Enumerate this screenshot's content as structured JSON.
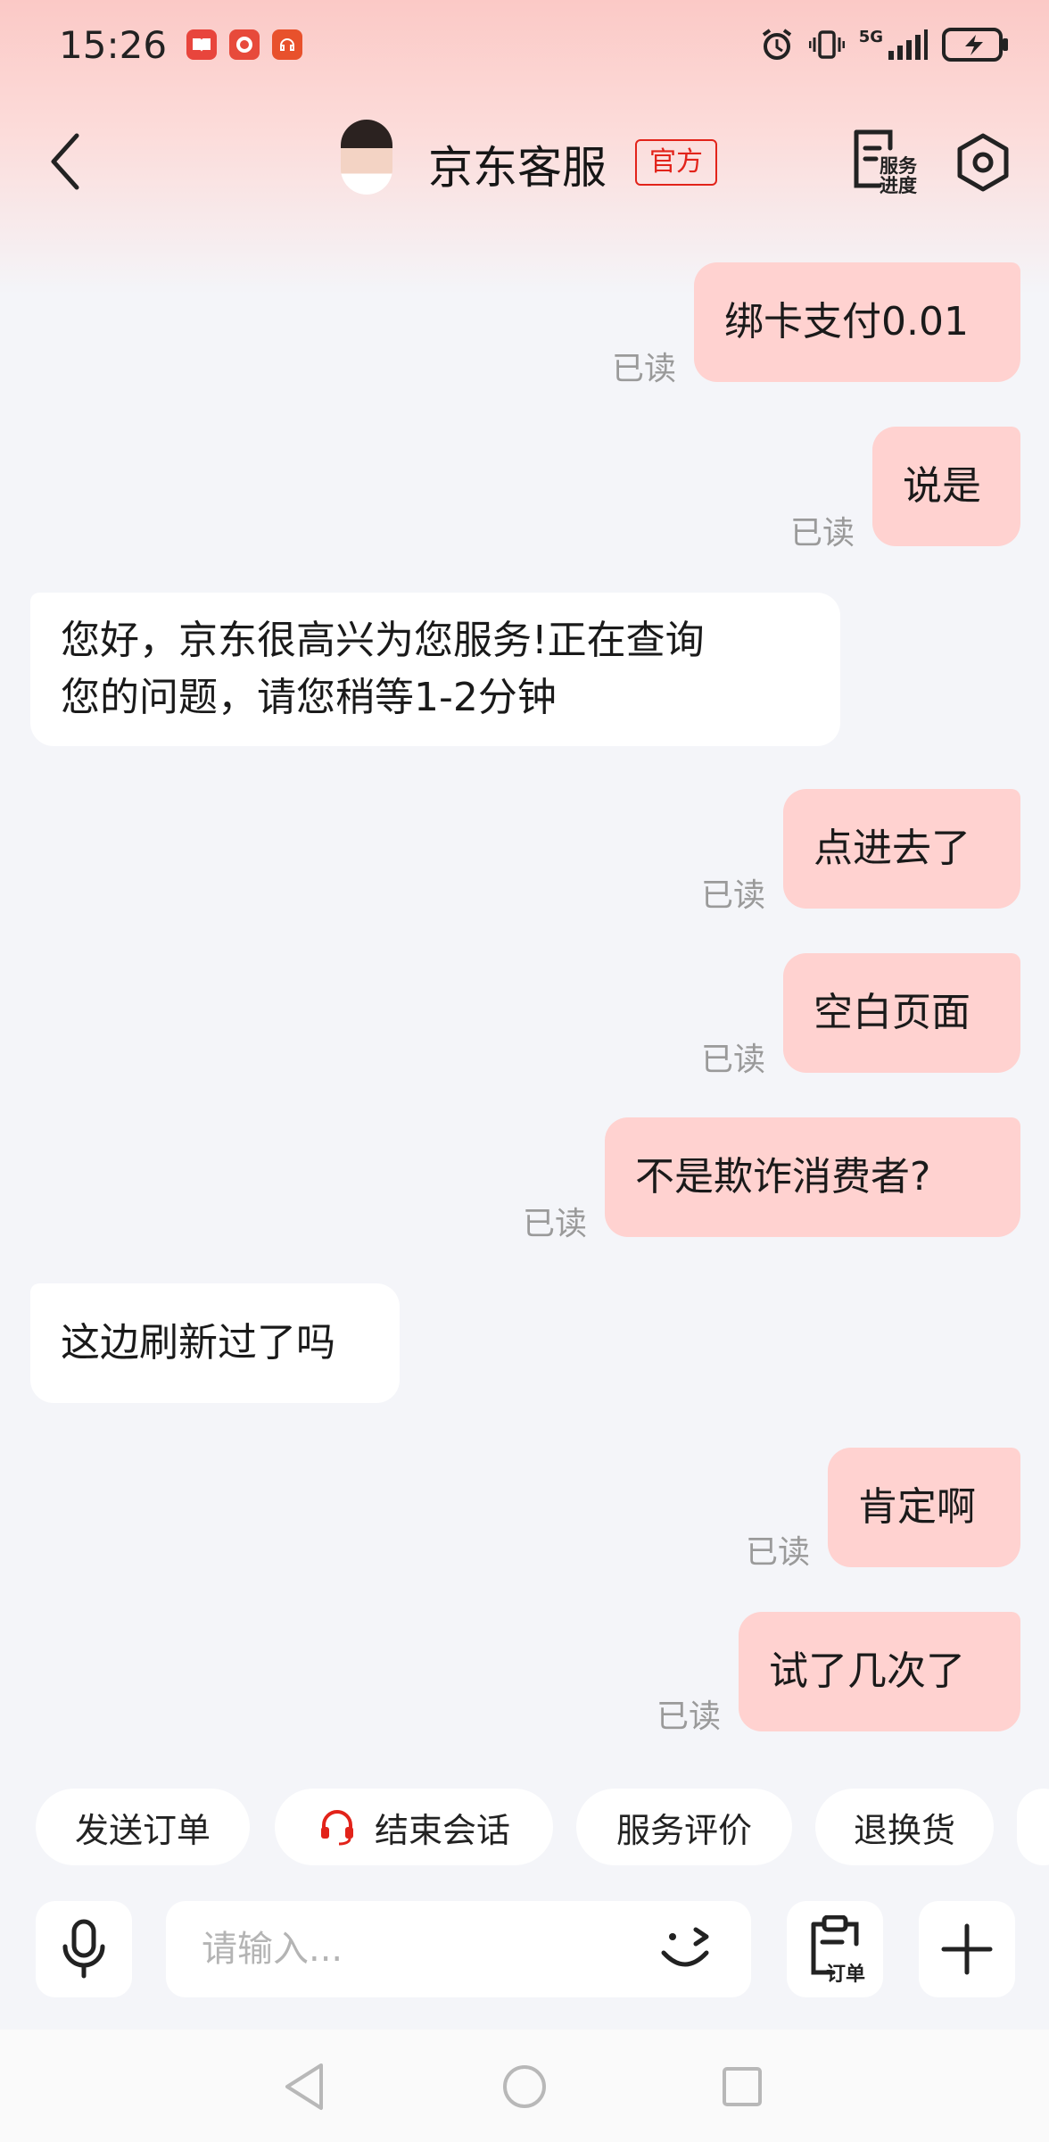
{
  "status_bar": {
    "time": "15:26",
    "network": "5G"
  },
  "header": {
    "title": "京东客服",
    "badge": "官方",
    "progress_label_line1": "服务",
    "progress_label_line2": "进度"
  },
  "messages": [
    {
      "text": "绑卡支付0.01",
      "read": "已读"
    },
    {
      "text": "说是",
      "read": "已读"
    },
    {
      "line1": "您好，京东很高兴为您服务!正在查询",
      "line2": "您的问题，请您稍等1-2分钟"
    },
    {
      "text": "点进去了",
      "read": "已读"
    },
    {
      "text": "空白页面",
      "read": "已读"
    },
    {
      "text": "不是欺诈消费者?",
      "read": "已读"
    },
    {
      "text": "这边刷新过了吗"
    },
    {
      "text": "肯定啊",
      "read": "已读"
    },
    {
      "text": "试了几次了",
      "read": "已读"
    }
  ],
  "quick_actions": [
    "发送订单",
    "结束会话",
    "服务评价",
    "退换货"
  ],
  "input": {
    "placeholder": "请输入...",
    "order_label": "订单"
  },
  "colors": {
    "accent": "#e2231a",
    "outgoing_bubble": "#ffd2d0",
    "incoming_bubble": "#ffffff",
    "background": "#f4f5f9"
  }
}
